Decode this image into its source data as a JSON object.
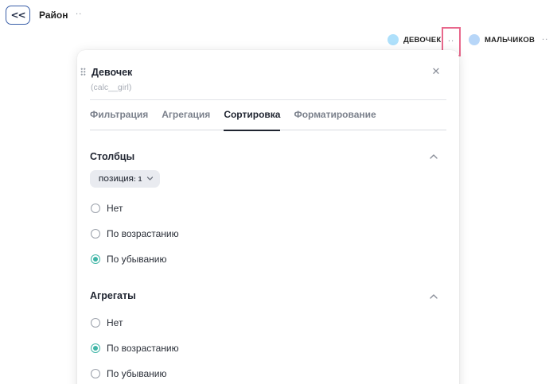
{
  "header": {
    "back_label": "<<",
    "title": "Район",
    "more_label": "··"
  },
  "legend": {
    "items": [
      {
        "label": "ДЕВОЧЕК",
        "color": "#aee0fb"
      },
      {
        "label": "МАЛЬЧИКОВ",
        "color": "#b7d6f8"
      }
    ],
    "more_label": "··"
  },
  "panel": {
    "title": "Девочек",
    "subtitle": "(calc__girl)",
    "close_icon": "close-icon",
    "tabs": [
      {
        "label": "Фильтрация",
        "active": false
      },
      {
        "label": "Агрегация",
        "active": false
      },
      {
        "label": "Сортировка",
        "active": true
      },
      {
        "label": "Форматирование",
        "active": false
      }
    ],
    "columns_section": {
      "title": "Столбцы",
      "position_pill": "ПОЗИЦИЯ: 1",
      "options": [
        {
          "label": "Нет",
          "checked": false
        },
        {
          "label": "По возрастанию",
          "checked": false
        },
        {
          "label": "По убыванию",
          "checked": true
        }
      ]
    },
    "aggregates_section": {
      "title": "Агрегаты",
      "options": [
        {
          "label": "Нет",
          "checked": false
        },
        {
          "label": "По возрастанию",
          "checked": true
        },
        {
          "label": "По убыванию",
          "checked": false
        }
      ]
    }
  },
  "colors": {
    "accent_radio": "#3fb5a6",
    "highlight_border": "#e8688c",
    "back_button_border": "#3a5fa8"
  }
}
